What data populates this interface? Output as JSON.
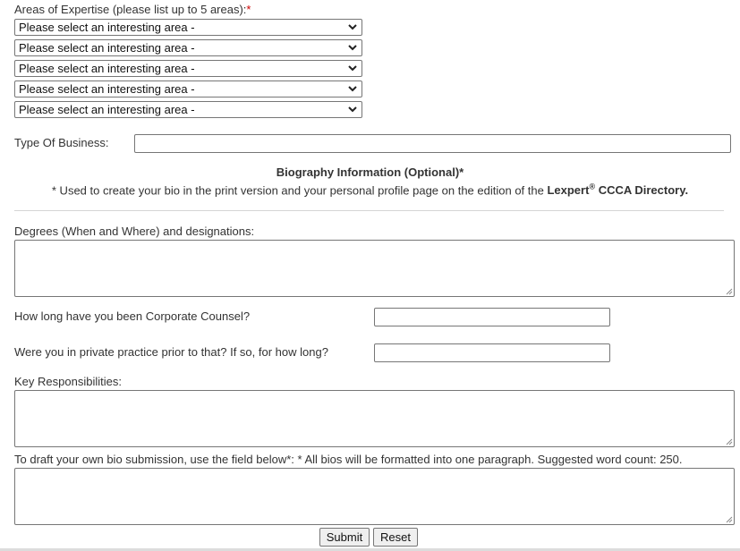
{
  "expertise": {
    "label": "Areas of Expertise (please list up to 5 areas):",
    "required_mark": "*",
    "selects": [
      {
        "value": "Please select an interesting area -"
      },
      {
        "value": "Please select an interesting area -"
      },
      {
        "value": "Please select an interesting area -"
      },
      {
        "value": "Please select an interesting area -"
      },
      {
        "value": "Please select an interesting area -"
      }
    ]
  },
  "business": {
    "label": "Type Of Business:",
    "value": ""
  },
  "bio_header": {
    "title": "Biography Information (Optional)*",
    "note_prefix": "* Used to create your bio in the print version and your personal profile page on the edition of the ",
    "brand": "Lexpert",
    "brand_sup": "®",
    "directory": " CCCA Directory."
  },
  "fields": {
    "degrees_label": "Degrees (When and Where) and designations:",
    "counsel_label": "How long have you been Corporate Counsel?",
    "practice_label": "Were you in private practice prior to that? If so, for how long?",
    "responsibilities_label": "Key Responsibilities:",
    "bio_label": "To draft your own bio submission, use the field below*: * All bios will be formatted into one paragraph. Suggested word count: 250."
  },
  "actions": {
    "submit": "Submit",
    "reset": "Reset"
  }
}
